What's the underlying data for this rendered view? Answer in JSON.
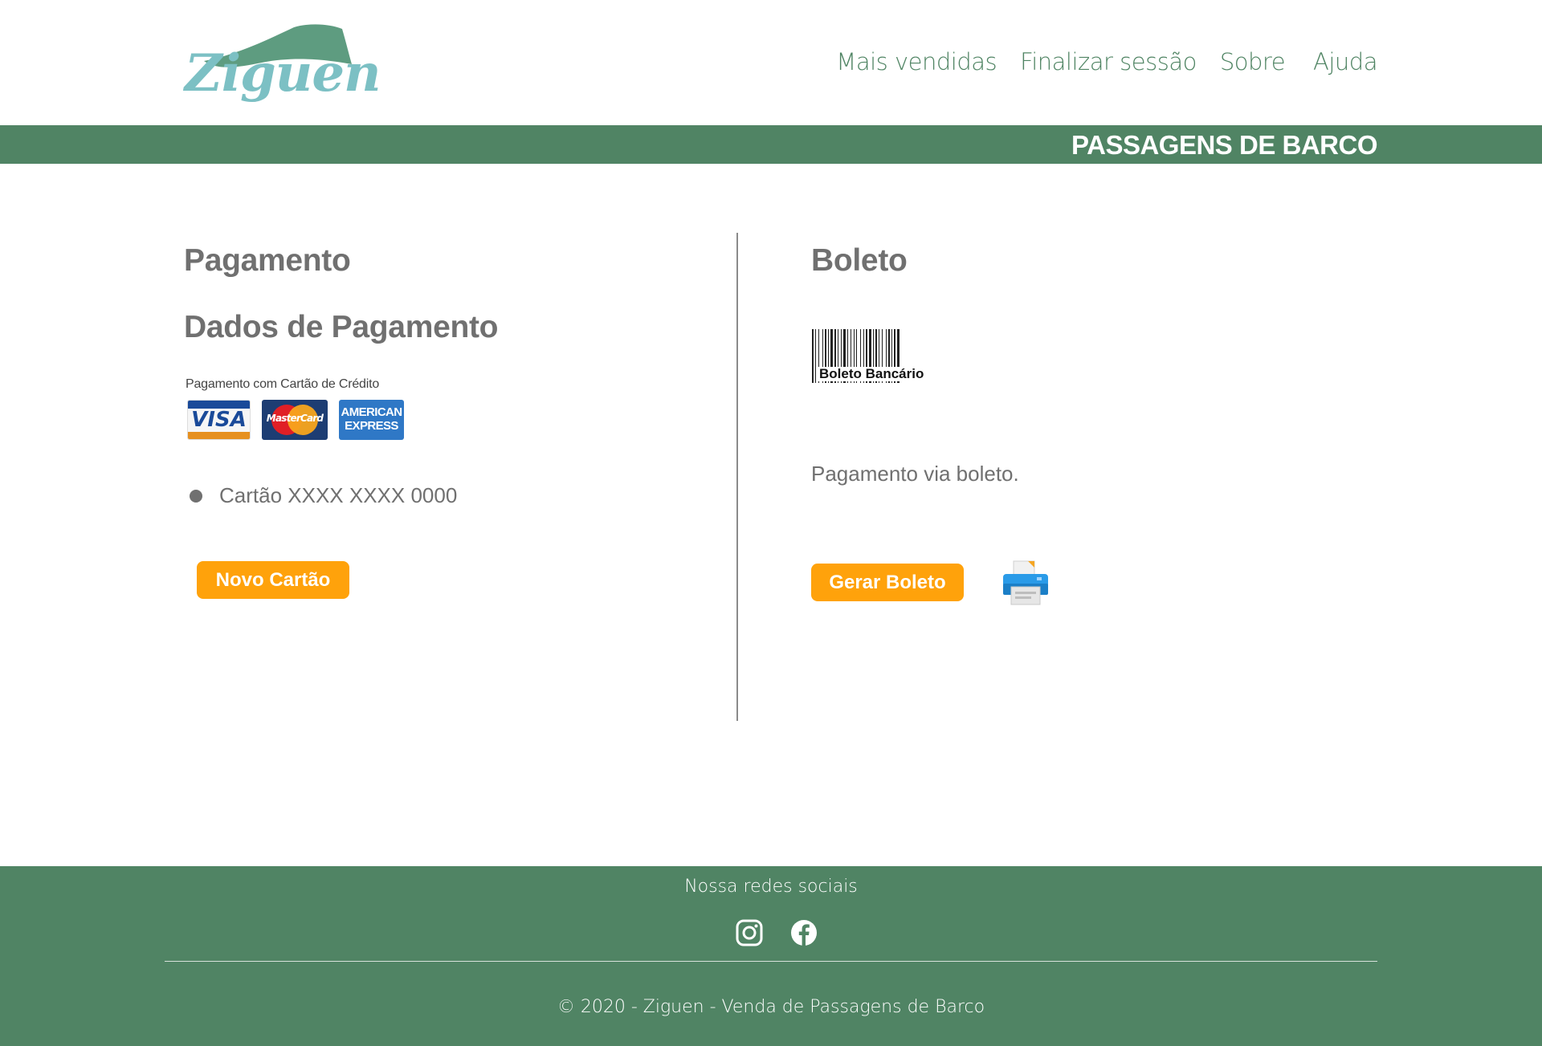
{
  "header": {
    "logo_text": "Ziguen",
    "nav": [
      "Mais vendidas",
      "Finalizar sessão",
      "Sobre",
      "Ajuda"
    ]
  },
  "banner": {
    "title": "PASSAGENS DE BARCO"
  },
  "payment": {
    "title": "Pagamento",
    "subtitle": "Dados de Pagamento",
    "cards_caption": "Pagamento com Cartão de Crédito",
    "card_brands": [
      "VISA",
      "MasterCard",
      "AMERICAN EXPRESS"
    ],
    "saved_card": "Cartão XXXX XXXX 0000",
    "new_card_button": "Novo Cartão"
  },
  "boleto": {
    "title": "Boleto",
    "barcode_label": "Boleto Bancário",
    "description": "Pagamento via boleto.",
    "generate_button": "Gerar Boleto",
    "print_icon": "printer-icon"
  },
  "footer": {
    "social_title": "Nossa redes sociais",
    "social_icons": [
      "instagram-icon",
      "facebook-icon"
    ],
    "copyright": "© 2020 - Ziguen - Venda de Passagens de Barco"
  },
  "colors": {
    "brand_green": "#508464",
    "nav_green": "#4f8463",
    "logo_teal": "#7cc0c4",
    "button_orange": "#ffa20b",
    "text_gray": "#707070"
  }
}
